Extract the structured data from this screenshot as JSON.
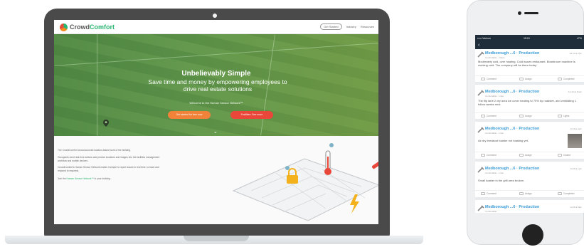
{
  "laptop_site": {
    "brand": {
      "part1": "Crowd",
      "part2": "Comfort"
    },
    "nav": {
      "pill": "Get Started",
      "link1": "Industry",
      "link2": "Resources"
    },
    "hero": {
      "title": "Unbelievably Simple",
      "subtitle": "Save time and money by empowering employees to drive real estate solutions",
      "welcome": "Welcome to the Human Sensor Network™",
      "button_primary": "Get started for free now",
      "button_secondary": "Facilities: See more"
    },
    "body": {
      "p1": "The CrowdComfort crowd-sourced location-based work of the building.",
      "p2": "Occupants send real-time actions and precise locations and images into the facilities management workflow and mobile devices.",
      "p3": "CrowdComfort's Human Sensor Network makes it simple to report issues in real time, to track and respond to requests.",
      "p4_prefix": "Join the ",
      "p4_link": "Human Sensor Network™",
      "p4_suffix": " in your building."
    }
  },
  "phone_app": {
    "status": {
      "carrier": "••••• Verizon",
      "time": "15:10",
      "battery": "47%"
    },
    "posts": [
      {
        "title": "Medborough ...6 · Production",
        "time": "Jul 11 at 2pm",
        "meta": "Comfortable · 2 likes",
        "body": "Moderately cold, over heating. Cold issues restaurant. Boardroom machine is working cold. The company will be there today.",
        "actions": [
          "Comment",
          "Assign",
          "Completed"
        ]
      },
      {
        "title": "Medborough ...6 · Production",
        "time": "Jul 10 at 11am",
        "meta": "Comfortable · 1 like",
        "body": "The flip lane 2 dry area ice cover heating to 70% by roadster, and ventilating 1 follow weeks next.",
        "actions": [
          "Comment",
          "Assign",
          "Lights"
        ]
      },
      {
        "title": "Medborough ...6 · Production",
        "time": "Jul 9 at 4pm",
        "meta": "Comfortable · 1 like",
        "body": "Air dry breakout toaster not toasting yet.",
        "actions": [
          "Comment",
          "Assign",
          "Closed"
        ]
      },
      {
        "title": "Medborough ...6 · Production",
        "time": "Jul 8 at 1pm",
        "meta": "Comfortable · 1 like",
        "body": "Small toaster in the grill area broken.",
        "actions": [
          "Comment",
          "Assign",
          "Completed"
        ]
      },
      {
        "title": "Medborough ...6 · Production",
        "time": "Jul 8 at 9am",
        "meta": "Comfortable",
        "body": "",
        "actions": []
      }
    ]
  },
  "colors": {
    "brand_green": "#2bb673",
    "orange": "#f0823a",
    "red": "#e9473a",
    "link_blue": "#3a9bd8",
    "device_dark": "#4a4a4a"
  }
}
